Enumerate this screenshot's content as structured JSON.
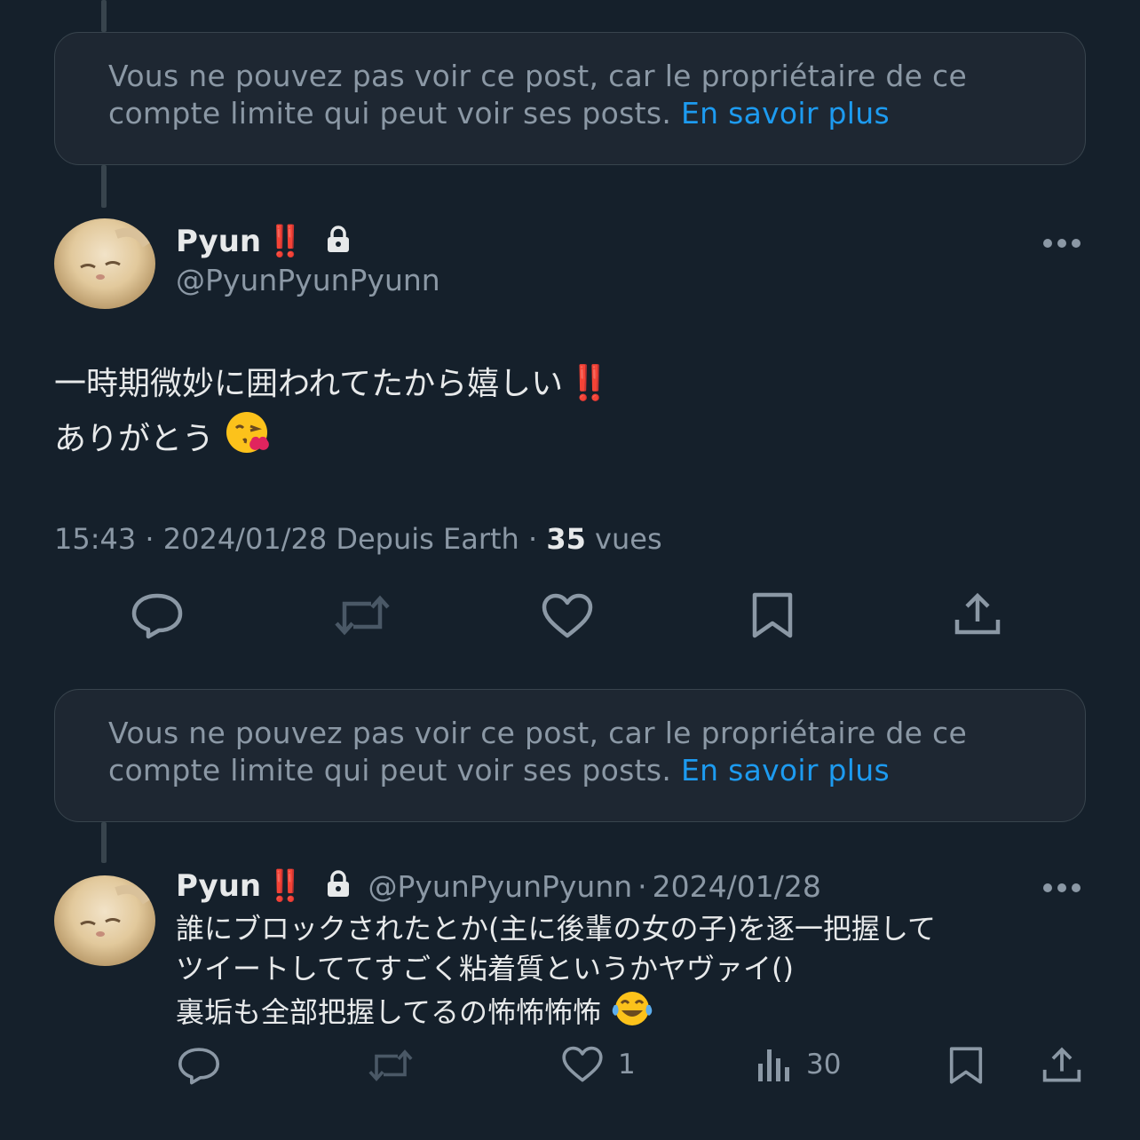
{
  "notices": [
    {
      "text": "Vous ne pouvez pas voir ce post, car le propriétaire de ce compte limite qui peut voir ses posts.",
      "link": "En savoir plus"
    },
    {
      "text": "Vous ne pouvez pas voir ce post, car le propriétaire de ce compte limite qui peut voir ses posts.",
      "link": "En savoir plus"
    }
  ],
  "main_tweet": {
    "display_name": "Pyun",
    "name_emoji": "‼️",
    "handle": "@PyunPyunPyunn",
    "line1": "一時期微妙に囲われてたから嬉しい",
    "line1_emoji": "‼️",
    "line2": "ありがとう",
    "line2_emoji": "😘",
    "time": "15:43",
    "sep1": "·",
    "date": "2024/01/28",
    "source": "Depuis Earth",
    "sep2": "·",
    "views_count": "35",
    "views_label": "vues"
  },
  "reply_tweet": {
    "display_name": "Pyun",
    "name_emoji": "‼️",
    "handle": "@PyunPyunPyunn",
    "sep": "·",
    "date": "2024/01/28",
    "line1": "誰にブロックされたとか(主に後輩の女の子)を逐一把握して",
    "line2": "ツイートしててすごく粘着質というかヤヴァイ()",
    "line3": "裏垢も全部把握してるの怖怖怖怖",
    "line3_emoji": "😂",
    "likes": "1",
    "views": "30"
  },
  "icons": {
    "lock": "lock-icon",
    "more": "more-icon",
    "reply": "reply-icon",
    "retweet": "retweet-icon",
    "like": "heart-icon",
    "bookmark": "bookmark-icon",
    "share": "share-icon",
    "views": "views-icon"
  },
  "colors": {
    "background": "#15202b",
    "link": "#1d9bf0",
    "muted": "#8b98a5",
    "text": "#e7e9ea"
  }
}
